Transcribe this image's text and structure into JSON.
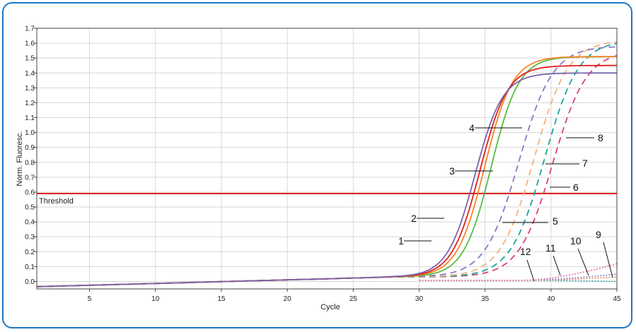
{
  "chart_data": {
    "type": "line",
    "xlabel": "Cycle",
    "ylabel": "Norm. Fluoresc.",
    "xlim": [
      1,
      45
    ],
    "ylim": [
      -0.05,
      1.7
    ],
    "x_ticks": [
      5,
      10,
      15,
      20,
      25,
      30,
      35,
      40,
      45
    ],
    "y_ticks": [
      "0.0",
      "0.1",
      "0.2",
      "0.3",
      "0.4",
      "0.5",
      "0.6",
      "0.7",
      "0.8",
      "0.9",
      "1.0",
      "1.1",
      "1.2",
      "1.3",
      "1.4",
      "1.5",
      "1.6",
      "1.7"
    ],
    "grid": true,
    "threshold": {
      "label": "Threshold",
      "value": 0.59,
      "color": "#e0201c"
    },
    "series": [
      {
        "name": "1",
        "color": "#e0201c",
        "style": "solid",
        "ct": 34.2,
        "plateau": 1.45
      },
      {
        "name": "2",
        "color": "#f4862a",
        "style": "solid",
        "ct": 34.5,
        "plateau": 1.51
      },
      {
        "name": "3",
        "color": "#5bb947",
        "style": "solid",
        "ct": 35.0,
        "plateau": 1.51
      },
      {
        "name": "4",
        "color": "#7a63b0",
        "style": "solid",
        "ct": 33.9,
        "plateau": 1.4
      },
      {
        "name": "5",
        "color": "#8b78c4",
        "style": "dashed",
        "ct": 36.9,
        "plateau": 1.58
      },
      {
        "name": "6",
        "color": "#d9427a",
        "style": "dashed",
        "ct": 39.5,
        "plateau": 1.55
      },
      {
        "name": "7",
        "color": "#f5b07a",
        "style": "dashed",
        "ct": 38.0,
        "plateau": 1.62
      },
      {
        "name": "8",
        "color": "#1aa59a",
        "style": "dashed",
        "ct": 38.8,
        "plateau": 1.62
      },
      {
        "name": "9",
        "color": "#e06aa8",
        "style": "dotted",
        "end": 0.12
      },
      {
        "name": "10",
        "color": "#8a7ec0",
        "style": "dotted",
        "end": 0.05
      },
      {
        "name": "11",
        "color": "#e58b5a",
        "style": "dotted",
        "end": 0.03
      },
      {
        "name": "12",
        "color": "#39a7a0",
        "style": "dotted",
        "end": 0.0
      }
    ]
  }
}
